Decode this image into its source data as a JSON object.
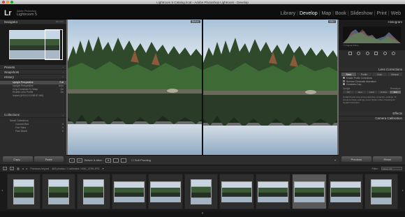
{
  "window": {
    "title": "Lightroom 5 Catalog.lrcat - Adobe Photoshop Lightroom - Develop"
  },
  "identity": {
    "logo": "Lr",
    "line1": "Adobe Photoshop",
    "line2": "Lightroom 5"
  },
  "modules": [
    {
      "label": "Library",
      "active": false
    },
    {
      "label": "Develop",
      "active": true
    },
    {
      "label": "Map",
      "active": false
    },
    {
      "label": "Book",
      "active": false
    },
    {
      "label": "Slideshow",
      "active": false
    },
    {
      "label": "Print",
      "active": false
    },
    {
      "label": "Web",
      "active": false
    }
  ],
  "left": {
    "navigator": {
      "title": "Navigator",
      "zoom": "FILL  FIT"
    },
    "presets": "Presets",
    "snapshots": "Snapshots",
    "history": {
      "title": "History",
      "items": [
        {
          "label": "Upright Perspective",
          "value": "Full"
        },
        {
          "label": "Upright Perspective",
          "value": "Auto"
        },
        {
          "label": "Crop Constrain To Warp",
          "value": "On"
        },
        {
          "label": "Enable Lens Profile",
          "value": "On"
        },
        {
          "label": "Import (6/11/13 10:58:57 AM)",
          "value": ""
        }
      ]
    },
    "collections": {
      "title": "Collections",
      "top": "Smart Collections",
      "items": [
        {
          "label": "Colored Red",
          "count": "0"
        },
        {
          "label": "Five Stars",
          "count": "0"
        },
        {
          "label": "Past Month",
          "count": "0"
        }
      ]
    },
    "copy": "Copy...",
    "paste": "Paste"
  },
  "center": {
    "before_label": "Before",
    "after_label": "After",
    "toolbar": {
      "xy": "XY",
      "mode": "Before & After :",
      "softproof": "Soft Proofing"
    }
  },
  "right": {
    "histogram": "Histogram",
    "original_photo": "Original Photo",
    "lens": {
      "title": "Lens Corrections",
      "tabs": [
        "Basic",
        "Profile",
        "Color",
        "Manual"
      ],
      "checks": [
        "Enable Profile Corrections",
        "Remove Chromatic Aberration",
        "Constrain Crop"
      ],
      "upright_label": "Upright",
      "reanalyze": "Reanalyze",
      "upright_buttons": [
        "Off",
        "Auto",
        "Level",
        "Vertical",
        "Full"
      ],
      "help": "Upright levels crop and perspective correction settings. To preserve these settings, press Option when choosing an Upright correction."
    },
    "effects": "Effects",
    "camera_cal": "Camera Calibration",
    "previous": "Previous",
    "reset": "Reset"
  },
  "filmstrip_bar": {
    "num1": "1",
    "num2": "2",
    "source": "Previous Import",
    "info": "463 photos / 1 selected / IMG_3705.JPG",
    "filter_label": "Filter :",
    "filter_value": "Filters Off"
  },
  "filmstrip": {
    "thumbs": [
      {
        "selected": false,
        "wide": false
      },
      {
        "selected": false,
        "wide": false
      },
      {
        "selected": false,
        "wide": false
      },
      {
        "selected": false,
        "wide": true
      },
      {
        "selected": false,
        "wide": true
      },
      {
        "selected": false,
        "wide": false
      },
      {
        "selected": false,
        "wide": true
      },
      {
        "selected": false,
        "wide": true
      },
      {
        "selected": true,
        "wide": true
      },
      {
        "selected": false,
        "wide": true
      },
      {
        "selected": false,
        "wide": false
      }
    ]
  },
  "colors": {
    "accent": "#ffffff",
    "panel": "#2b2b2b",
    "selected_thumb": "#585858"
  }
}
